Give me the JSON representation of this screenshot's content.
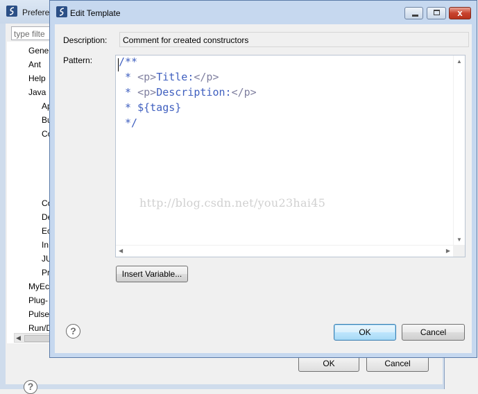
{
  "preferences": {
    "title": "Prefere",
    "filter_placeholder": "type filte",
    "tree": [
      "Gene",
      "Ant",
      "Help",
      "Java",
      "Ap",
      "Bu",
      "Co",
      "Co",
      "De",
      "Ec",
      "In",
      "JU",
      "Pr",
      "MyEc",
      "Plug-",
      "Pulse",
      "Run/D"
    ],
    "ok_label": "OK",
    "cancel_label": "Cancel",
    "help_glyph": "?"
  },
  "dialog": {
    "title": "Edit Template",
    "description_label": "Description:",
    "description_value": "Comment for created constructors",
    "pattern_label": "Pattern:",
    "pattern_lines": [
      "/**",
      " * ",
      " * ",
      " * ${tags}",
      " */"
    ],
    "pattern_tag_open": "<p>",
    "pattern_tag_close": "</p>",
    "pattern_line2_text": "Title:",
    "pattern_line3_text": "Description:",
    "watermark": "http://blog.csdn.net/you23hai45",
    "insert_variable_label": "Insert Variable...",
    "ok_label": "OK",
    "cancel_label": "Cancel",
    "help_glyph": "?",
    "close_glyph": "x"
  },
  "colors": {
    "code_text": "#3f5fbf",
    "code_tag": "#7f7f9f",
    "default_button_border": "#3c7fb1"
  }
}
